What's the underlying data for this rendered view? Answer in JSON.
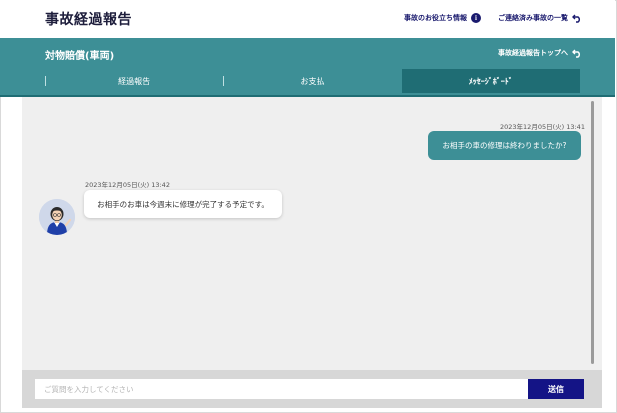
{
  "header": {
    "title": "事故経過報告",
    "links": [
      {
        "label": "事故のお役立ち情報",
        "icon": "info-icon"
      },
      {
        "label": "ご連絡済み事故の一覧",
        "icon": "back-arrow-icon"
      }
    ]
  },
  "band": {
    "title": "対物賠償(車両)",
    "top_link": {
      "label": "事故経過報告トップへ",
      "icon": "back-arrow-icon"
    }
  },
  "tabs": [
    {
      "label": "経過報告",
      "active": false
    },
    {
      "label": "お支払",
      "active": false
    },
    {
      "label": "ﾒｯｾｰｼﾞﾎﾞｰﾄﾞ",
      "active": true
    }
  ],
  "messages": [
    {
      "side": "right",
      "timestamp": "2023年12月05日(火) 13:41",
      "text": "お相手の車の修理は終わりましたか?"
    },
    {
      "side": "left",
      "timestamp": "2023年12月05日(火) 13:42",
      "text": "お相手のお車は今週末に修理が完了する予定です。"
    }
  ],
  "composer": {
    "placeholder": "ご質問を入力してください",
    "value": "",
    "send_label": "送信"
  },
  "colors": {
    "teal": "#3d8f96",
    "teal_dark": "#1f6d74",
    "navy": "#141486"
  }
}
